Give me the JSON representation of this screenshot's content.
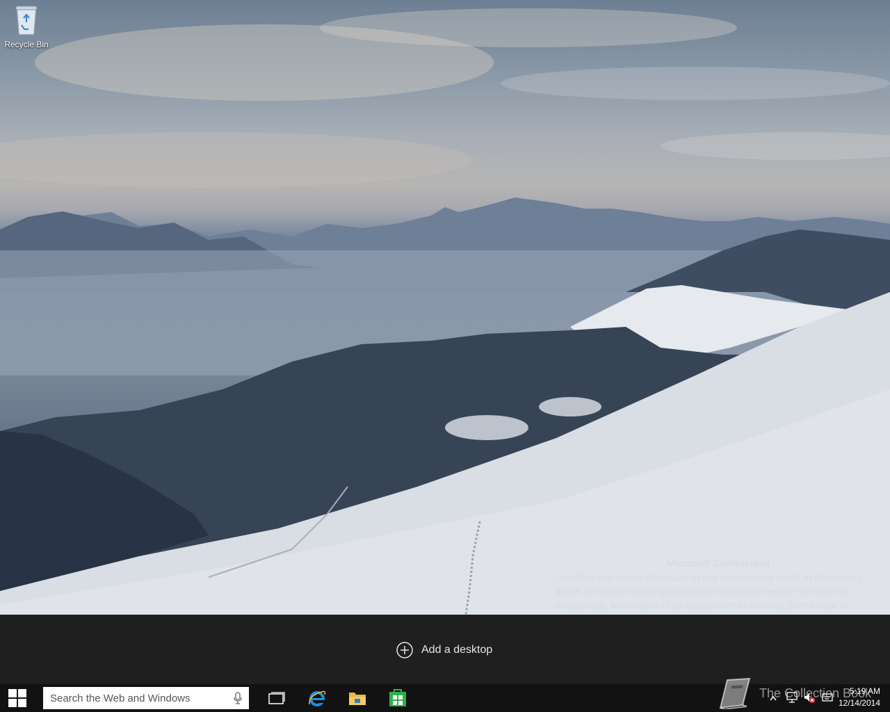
{
  "desktop": {
    "recycle_bin_label": "Recycle Bin"
  },
  "watermark": {
    "title": "Microsoft Confidential",
    "body": "Unauthorized use or disclosure in any manner may result in disciplinary action up to and including termination of employment (in the case of employees), termination of an assignment or contract (in the case of"
  },
  "task_view": {
    "add_desktop_label": "Add a desktop"
  },
  "taskbar": {
    "search_placeholder": "Search the Web and Windows",
    "pinned": [
      "task-view",
      "internet-explorer",
      "file-explorer",
      "store"
    ],
    "clock_time": "5:19 AM",
    "clock_date": "12/14/2014"
  },
  "overlay": {
    "collection_text": "The Collection Book"
  },
  "colors": {
    "taskbar_bg": "#121212",
    "taskview_bg": "#1f1f1f",
    "ie_blue": "#1e90e0",
    "store_green": "#2db14a",
    "explorer_yellow": "#e8b640"
  }
}
